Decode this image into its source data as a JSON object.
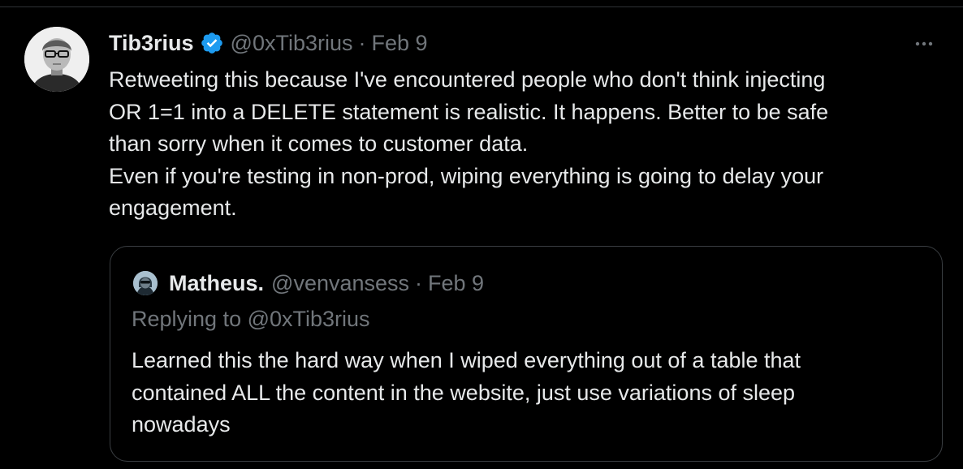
{
  "tweet": {
    "author": {
      "display_name": "Tib3rius",
      "handle": "@0xTib3rius",
      "verified": true
    },
    "separator": "·",
    "date": "Feb 9",
    "more_icon": "ellipsis-icon",
    "text_lines": [
      "Retweeting this because I've encountered people who don't think injecting",
      "OR 1=1 into a DELETE statement is realistic. It happens. Better to be safe",
      "than sorry when it comes to customer data.",
      "Even if you're testing in non-prod, wiping everything is going to delay your",
      "engagement."
    ]
  },
  "quoted": {
    "author": {
      "display_name": "Matheus.",
      "handle": "@venvansess"
    },
    "separator": "·",
    "date": "Feb 9",
    "replying_to": "Replying to @0xTib3rius",
    "text_lines": [
      "Learned this the hard way when I wiped everything out of a table that",
      "contained ALL the content in the website, just use variations of sleep",
      "nowadays"
    ]
  },
  "colors": {
    "background": "#000000",
    "text_primary": "#e7e9ea",
    "text_secondary": "#71767b",
    "verified_blue": "#1d9bf0",
    "border": "#2f3336"
  }
}
